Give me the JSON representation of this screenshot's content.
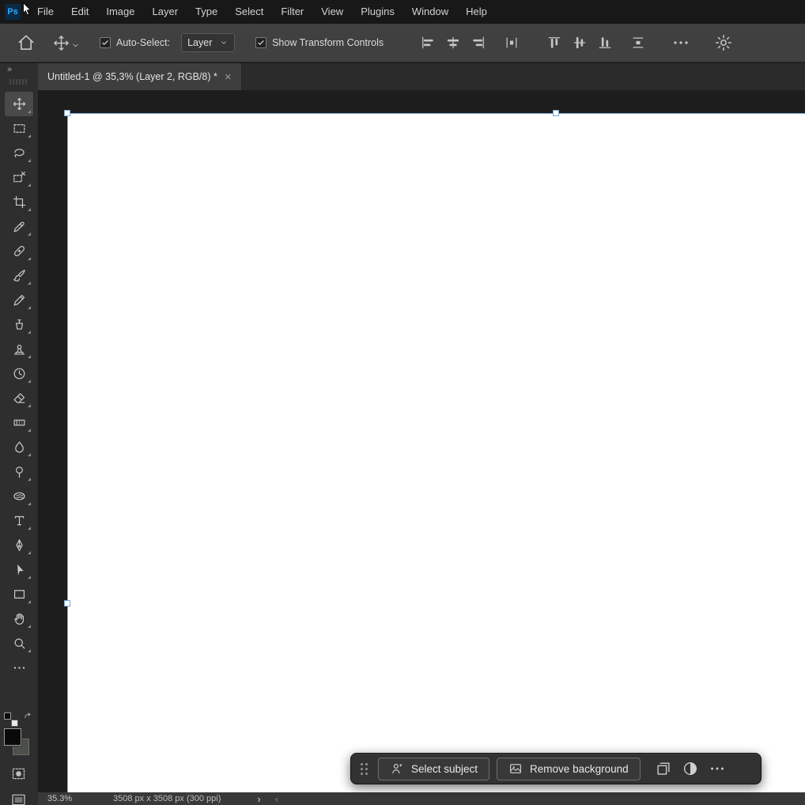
{
  "colors": {
    "accent": "#31a8ff",
    "selection": "#7aa9d9",
    "canvas": "#ffffff"
  },
  "menu_bar": {
    "logo_text": "Ps",
    "items": [
      "File",
      "Edit",
      "Image",
      "Layer",
      "Type",
      "Select",
      "Filter",
      "View",
      "Plugins",
      "Window",
      "Help"
    ]
  },
  "options_bar": {
    "auto_select_label": "Auto-Select:",
    "auto_select_checked": true,
    "target_value": "Layer",
    "show_transform_label": "Show Transform Controls",
    "show_transform_checked": true,
    "align_groups": [
      [
        "align-left",
        "align-center-horizontal",
        "align-right"
      ],
      [
        "distribute-horizontal-centers"
      ],
      [
        "align-top",
        "align-center-vertical",
        "align-bottom"
      ],
      [
        "distribute-vertical-centers"
      ]
    ]
  },
  "tab_bar": {
    "title": "Untitled-1 @ 35,3% (Layer 2, RGB/8) *",
    "close_glyph": "×"
  },
  "toolbar": {
    "collapse_glyph": "»",
    "tools": [
      {
        "name": "move",
        "selected": true
      },
      {
        "name": "rectangular-marquee"
      },
      {
        "name": "lasso"
      },
      {
        "name": "object-selection"
      },
      {
        "name": "crop"
      },
      {
        "name": "eyedropper"
      },
      {
        "name": "spot-healing-brush"
      },
      {
        "name": "brush"
      },
      {
        "name": "pencil"
      },
      {
        "name": "mixer-brush"
      },
      {
        "name": "clone-stamp"
      },
      {
        "name": "history-brush"
      },
      {
        "name": "eraser"
      },
      {
        "name": "gradient"
      },
      {
        "name": "blur"
      },
      {
        "name": "dodge"
      },
      {
        "name": "sponge"
      },
      {
        "name": "type"
      },
      {
        "name": "pen"
      },
      {
        "name": "path-selection"
      },
      {
        "name": "rectangle"
      },
      {
        "name": "hand"
      },
      {
        "name": "zoom"
      },
      {
        "name": "more-tools"
      }
    ],
    "foreground_color": "#0a0a0a",
    "background_color": "#4b5148"
  },
  "context_bar": {
    "buttons": [
      {
        "name": "select-subject",
        "label": "Select subject",
        "icon": "person-sparkle"
      },
      {
        "name": "remove-background",
        "label": "Remove background",
        "icon": "image"
      }
    ],
    "icon_buttons": [
      "transform",
      "adjustments",
      "more"
    ]
  },
  "status_bar": {
    "zoom": "35.3%",
    "doc_info": "3508 px x 3508 px (300 ppi)",
    "chevron_right": "›",
    "chevron_left": "‹"
  }
}
